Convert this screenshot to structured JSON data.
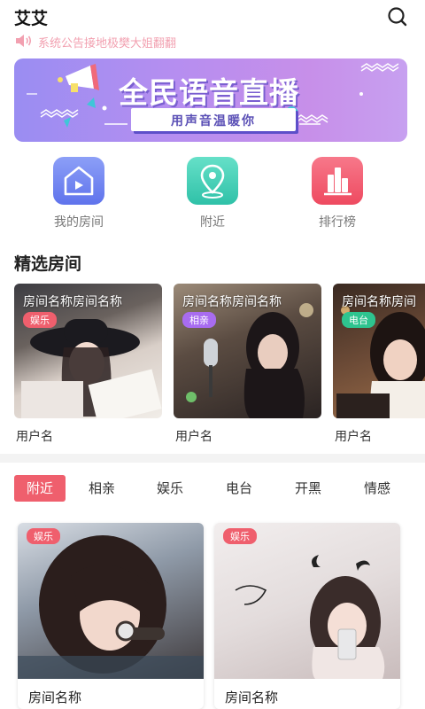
{
  "app": {
    "title": "艾艾"
  },
  "header": {
    "search_icon": "search-icon"
  },
  "notice": {
    "icon": "speaker-icon",
    "text": "系统公告接地极樊大姐翻翻",
    "color": "#f2a0b0"
  },
  "banner": {
    "title": "全民语音直播",
    "subtitle": "用声音温暖你",
    "gradient_from": "#9a8df2",
    "gradient_to": "#c7a0f0"
  },
  "quick_nav": [
    {
      "label": "我的房间",
      "icon": "home-play-icon",
      "color": "#6f86f0"
    },
    {
      "label": "附近",
      "icon": "location-pin-icon",
      "color": "#3fd0b8"
    },
    {
      "label": "排行榜",
      "icon": "ranking-bars-icon",
      "color": "#f0566a"
    }
  ],
  "featured": {
    "title": "精选房间",
    "rooms": [
      {
        "name": "房间名称房间名称",
        "tag": "娱乐",
        "tag_color": "#ef5f6d",
        "user": "用户名"
      },
      {
        "name": "房间名称房间名称",
        "tag": "相亲",
        "tag_color": "#a86cf0",
        "user": "用户名"
      },
      {
        "name": "房间名称房间",
        "tag": "电台",
        "tag_color": "#2ec48f",
        "user": "用户名"
      }
    ]
  },
  "tabs": {
    "items": [
      "附近",
      "相亲",
      "娱乐",
      "电台",
      "开黑",
      "情感"
    ],
    "active": "附近",
    "active_color": "#ef5f6d"
  },
  "rooms": [
    {
      "name": "房间名称",
      "tag": "娱乐"
    },
    {
      "name": "房间名称",
      "tag": "娱乐"
    }
  ]
}
